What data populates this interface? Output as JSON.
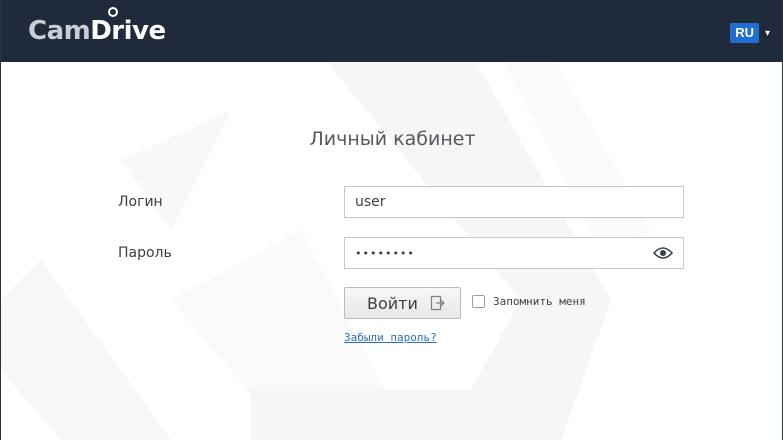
{
  "header": {
    "logo_part1": "Cam",
    "logo_part2": "Drive",
    "language": "RU",
    "language_caret": "▾"
  },
  "login": {
    "title": "Личный кабинет",
    "login_label": "Логин",
    "login_value": "user",
    "password_label": "Пароль",
    "password_value": "••••••••",
    "submit_label": "Войти",
    "remember_label": "Запомнить меня",
    "remember_checked": false,
    "forgot_link": "Забыли пароль?"
  },
  "colors": {
    "topbar": "#1f2a3a",
    "accent": "#1e6fd0",
    "link": "#2a6fc0"
  },
  "icons": [
    "show-password-eye-icon",
    "login-arrow-icon",
    "language-caret-icon"
  ]
}
